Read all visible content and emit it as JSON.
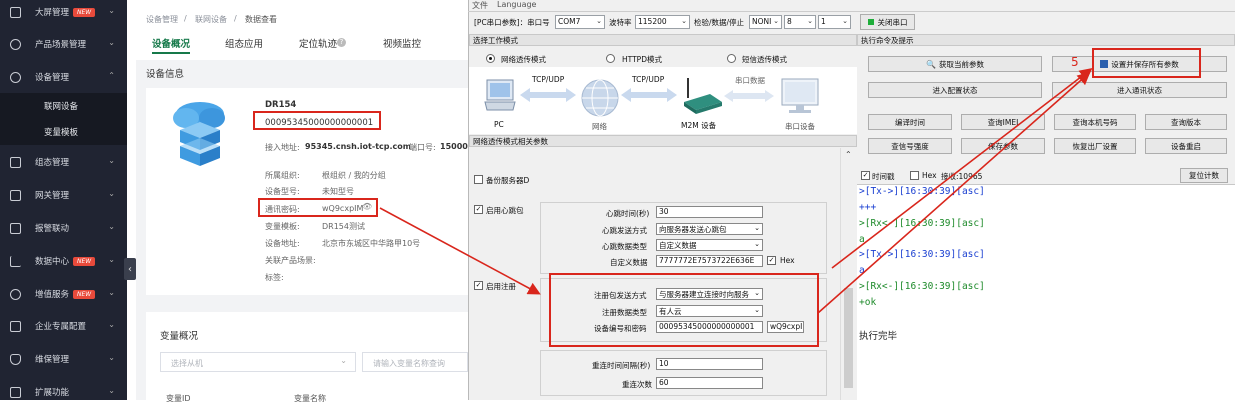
{
  "sidebar": {
    "items": [
      {
        "label": "大屏管理",
        "badge": "NEW",
        "chevron": "⌄"
      },
      {
        "label": "产品场景管理",
        "chevron": "⌄"
      },
      {
        "label": "设备管理",
        "chevron": "⌃"
      },
      {
        "label": "组态管理",
        "chevron": "⌄"
      },
      {
        "label": "网关管理",
        "chevron": "⌄"
      },
      {
        "label": "报警联动",
        "chevron": "⌄"
      },
      {
        "label": "数据中心",
        "badge": "NEW",
        "chevron": "⌄"
      },
      {
        "label": "增值服务",
        "badge": "NEW",
        "chevron": "⌄"
      },
      {
        "label": "企业专属配置",
        "chevron": "⌄"
      },
      {
        "label": "维保管理",
        "chevron": "⌄"
      },
      {
        "label": "扩展功能",
        "chevron": "⌄"
      }
    ],
    "subitems": [
      "联网设备",
      "变量模板"
    ],
    "collapse": "‹"
  },
  "web": {
    "breadcrumb": [
      "设备管理",
      "联网设备",
      "数据查看"
    ],
    "breadcrumb_sep": "/",
    "tabs": [
      "设备概况",
      "组态应用",
      "定位轨迹",
      "视频监控"
    ],
    "section_title": "设备信息",
    "device_name": "DR154",
    "device_id": "00095345000000000001",
    "access_label": "接入地址:",
    "access_value": "95345.cnsh.iot-tcp.com",
    "port_label": "端口号:",
    "port_value": "15000",
    "fields": [
      {
        "label": "所属组织:",
        "value": "根组织  /  我的分组"
      },
      {
        "label": "设备型号:",
        "value": "未知型号"
      },
      {
        "label": "通讯密码:",
        "value": "wQ9cxpIM"
      },
      {
        "label": "变量模板:",
        "value": "DR154测试"
      },
      {
        "label": "设备地址:",
        "value": "北京市东城区中华路甲10号"
      },
      {
        "label": "关联产品场景:",
        "value": ""
      },
      {
        "label": "标签:",
        "value": ""
      }
    ],
    "overview_title": "变量概况",
    "select_placeholder": "选择从机",
    "search_placeholder": "请输入变量名称查询",
    "table_headers": [
      "变量ID",
      "变量名称"
    ]
  },
  "app": {
    "menu": [
      "文件",
      "Language"
    ],
    "serial_label": "[PC串口参数]：串口号",
    "com": "COM7",
    "baud_label": "波特率",
    "baud": "115200",
    "parity_label": "检验/数据/停止",
    "parity": "NONI",
    "databits": "8",
    "stopbits": "1",
    "close_port": "关闭串口",
    "mode_section": "选择工作模式",
    "modes": [
      "网络透传模式",
      "HTTPD模式",
      "短信透传模式"
    ],
    "diagram": {
      "pc": "PC",
      "tcp1": "TCP/UDP",
      "network": "网络",
      "tcp2": "TCP/UDP",
      "m2m": "M2M 设备",
      "serial_data": "串口数据",
      "serial_dev": "串口设备"
    },
    "params_section": "网络透传模式相关参数",
    "backup_server": "备份服务器D",
    "heartbeat": {
      "enable": "启用心跳包",
      "time_label": "心跳时间(秒)",
      "time": "30",
      "method_label": "心跳发送方式",
      "method": "向服务器发送心跳包",
      "type_label": "心跳数据类型",
      "type": "自定义数据",
      "custom_label": "自定义数据",
      "custom": "7777772E7573722E636E",
      "hex": "Hex"
    },
    "register": {
      "enable": "启用注册",
      "method_label": "注册包发送方式",
      "method": "与服务器建立连接时向服务",
      "type_label": "注册数据类型",
      "type": "有人云",
      "id_label": "设备编号和密码",
      "id": "00095345000000000001",
      "pwd": "wQ9cxpI"
    },
    "retry_interval_label": "重连时间间隔(秒)",
    "retry_interval": "10",
    "retry_count_label": "重连次数",
    "retry_count": "60",
    "cmd_section": "执行命令及提示",
    "buttons": {
      "get_params": "获取当前参数",
      "save_all": "设置并保存所有参数",
      "enter_config": "进入配置状态",
      "enter_comm": "进入通讯状态",
      "row3": [
        "编译时间",
        "查询IMEI",
        "查询本机号码",
        "查询版本"
      ],
      "row4": [
        "查信号强度",
        "保存参数",
        "恢复出厂设置",
        "设备重启"
      ]
    },
    "timestamp": "时间戳",
    "hex_chk": "Hex",
    "recv_label": "接收:10965",
    "reset_count": "复位计数",
    "console": [
      {
        "text": ">[Tx->][16:30:39][asc]",
        "color": "#1a3fd1"
      },
      {
        "text": "+++",
        "color": "#1a3fd1"
      },
      {
        "text": ">[Rx<-][16:30:39][asc]",
        "color": "#1d8a2a"
      },
      {
        "text": "a",
        "color": "#1d8a2a"
      },
      {
        "text": ">[Tx->][16:30:39][asc]",
        "color": "#1a3fd1"
      },
      {
        "text": "a",
        "color": "#1a3fd1"
      },
      {
        "text": ">[Rx<-][16:30:39][asc]",
        "color": "#1d8a2a"
      },
      {
        "text": "+ok",
        "color": "#1d8a2a"
      },
      {
        "text": "执行完毕",
        "color": "#222"
      }
    ],
    "step_number": "5"
  },
  "colors": {
    "annotation_red": "#d9261c",
    "accent_green": "#16794a",
    "sidebar_bg": "#202432"
  }
}
